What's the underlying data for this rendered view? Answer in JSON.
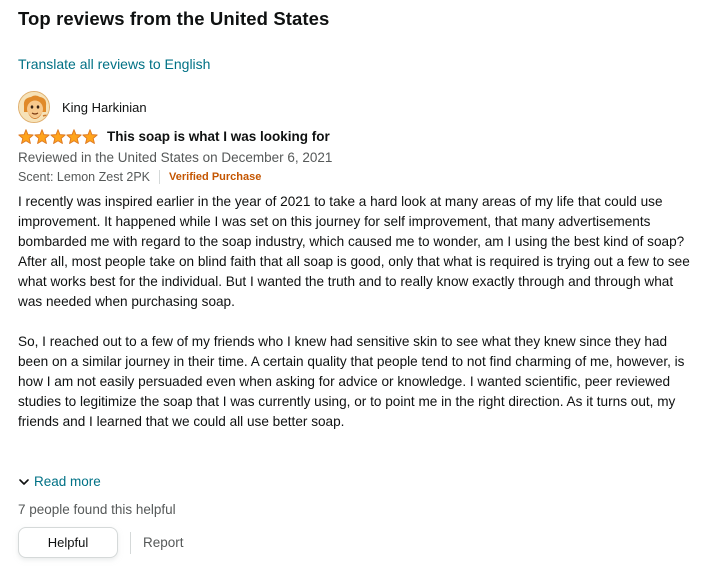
{
  "section": {
    "heading": "Top reviews from the United States",
    "translate_link": "Translate all reviews to English"
  },
  "review": {
    "reviewer_name": "King Harkinian",
    "rating": 5,
    "rating_max": 5,
    "star_color": "#ffa41c",
    "title": "This soap is what I was looking for",
    "date": "Reviewed in the United States on December 6, 2021",
    "scent": "Scent: Lemon Zest 2PK",
    "verified": "Verified Purchase",
    "body": {
      "p1": "I recently was inspired earlier in the year of 2021 to take a hard look at many areas of my life that could use improvement. It happened while I was set on this journey for self improvement, that many advertisements bombarded me with regard to the soap industry, which caused me to wonder, am I using the best kind of soap?",
      "p2": "After all, most people take on blind faith that all soap is good, only that what is required is trying out a few to see what works best for the individual. But I wanted the truth and to really know exactly through and through what was needed when purchasing soap.",
      "p3": "So, I reached out to a few of my friends who I knew had sensitive skin to see what they knew since they had been on a similar journey in their time. A certain quality that people tend to not find charming of me, however, is how I am not easily persuaded even when asking for advice or knowledge. I wanted scientific, peer reviewed studies to legitimize the soap that I was currently using, or to point me in the right direction. As it turns out, my friends and I learned that we could all use better soap."
    },
    "read_more": "Read more",
    "helpful_count": "7 people found this helpful",
    "helpful_button": "Helpful",
    "report_link": "Report"
  },
  "colors": {
    "link": "#007185",
    "verified": "#c45500",
    "secondary_text": "#565959"
  }
}
